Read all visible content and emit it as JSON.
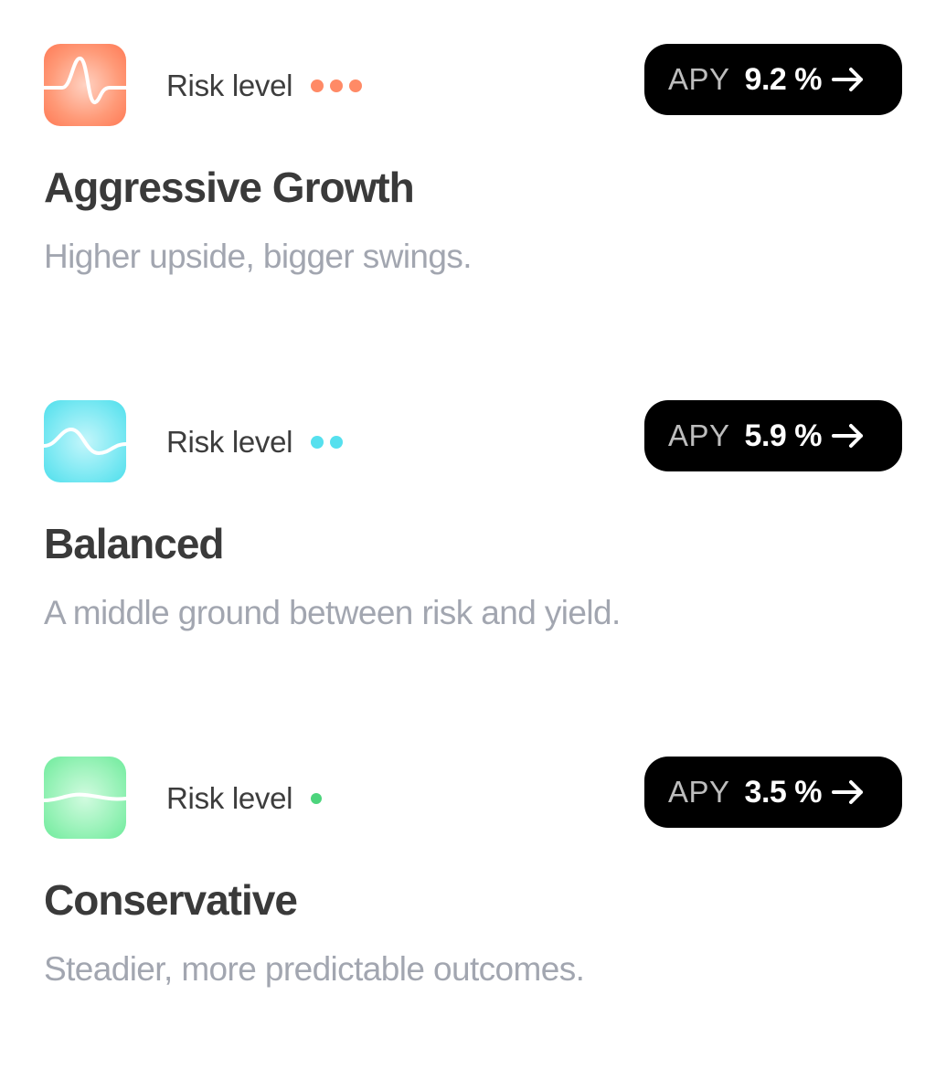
{
  "strategies": [
    {
      "icon": "sharp-wave-icon",
      "icon_color": "#ff7a55",
      "risk_label": "Risk level",
      "risk_level": 3,
      "risk_dot_color": "#ff8a66",
      "apy_label": "APY",
      "apy_value": "9.2 %",
      "title": "Aggressive Growth",
      "description": "Higher upside, bigger swings."
    },
    {
      "icon": "medium-wave-icon",
      "icon_color": "#4fe0ec",
      "risk_label": "Risk level",
      "risk_level": 2,
      "risk_dot_color": "#56e0ee",
      "apy_label": "APY",
      "apy_value": "5.9 %",
      "title": "Balanced",
      "description": "A middle ground between risk and yield."
    },
    {
      "icon": "gentle-wave-icon",
      "icon_color": "#6fec9c",
      "risk_label": "Risk level",
      "risk_level": 1,
      "risk_dot_color": "#4cd47c",
      "apy_label": "APY",
      "apy_value": "3.5 %",
      "title": "Conservative",
      "description": "Steadier, more predictable outcomes."
    }
  ]
}
